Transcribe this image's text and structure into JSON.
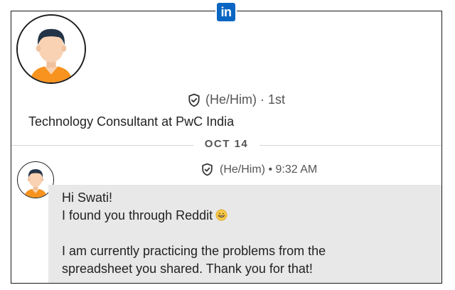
{
  "profile": {
    "pronouns": "(He/Him)",
    "degree": "1st",
    "headline": "Technology Consultant at PwC India"
  },
  "date_separator": "OCT 14",
  "message": {
    "pronouns": "(He/Him)",
    "time": "9:32 AM",
    "lines": [
      "Hi Swati!",
      "I found you through Reddit",
      "",
      "I am currently practicing the problems from the",
      "spreadsheet you shared. Thank you for that!"
    ],
    "emoji": "grinning-face-emoji"
  },
  "colors": {
    "linkedin_blue": "#0a66c2",
    "message_bubble": "#e8e8e8",
    "avatar_skin": "#f9d2b3",
    "avatar_hair": "#243447",
    "avatar_shirt": "#f7931e"
  }
}
